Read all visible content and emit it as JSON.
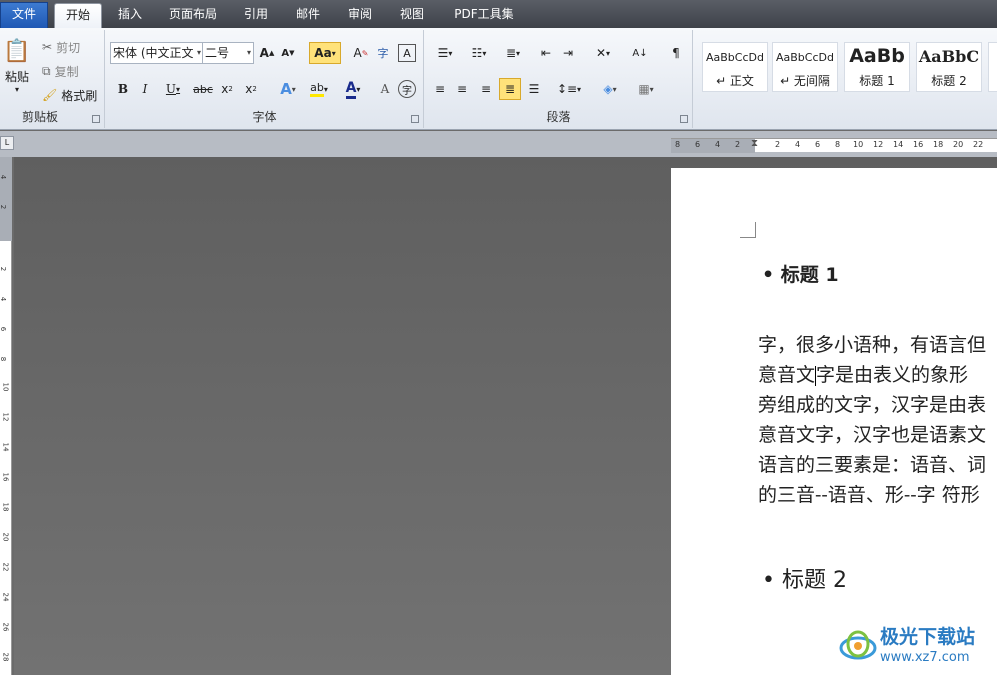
{
  "tabs": [
    "文件",
    "开始",
    "插入",
    "页面布局",
    "引用",
    "邮件",
    "审阅",
    "视图",
    "PDF工具集"
  ],
  "clipboard": {
    "paste": "粘贴",
    "cut": "剪切",
    "copy": "复制",
    "format_painter": "格式刷",
    "label": "剪贴板"
  },
  "font": {
    "name": "宋体 (中文正文",
    "size": "二号",
    "label": "字体"
  },
  "paragraph": {
    "label": "段落"
  },
  "styles": [
    {
      "sample": "AaBbCcDd",
      "name": "↵ 正文"
    },
    {
      "sample": "AaBbCcDd",
      "name": "↵ 无间隔"
    },
    {
      "sample": "AaBb",
      "name": "标题 1"
    },
    {
      "sample": "AaBbC",
      "name": "标题 2"
    }
  ],
  "ruler_h": [
    "8",
    "6",
    "4",
    "2",
    "2",
    "4",
    "6",
    "8",
    "10",
    "12",
    "14",
    "16",
    "18",
    "20",
    "22"
  ],
  "ruler_v": [
    "4",
    "2",
    "2",
    "4",
    "6",
    "8",
    "10",
    "12",
    "14",
    "16",
    "18",
    "20",
    "22",
    "24",
    "26",
    "28"
  ],
  "document": {
    "heading1": "• 标题 1",
    "lines": [
      "字，很多小语种，有语言但",
      "意音文",
      "字是由表义的象形",
      "旁组成的文字，汉字是由表",
      "意音文字，汉字也是语素文",
      "语言的三要素是：语音、词",
      "的三音--语音、形--字  符形"
    ],
    "heading2": "• 标题 2"
  },
  "watermark": {
    "title": "极光下载站",
    "url": "www.xz7.com"
  },
  "colors": {
    "file_tab": "#2a64c0",
    "canvas": "#6b6b6b",
    "highlight": "#ffe27a"
  }
}
